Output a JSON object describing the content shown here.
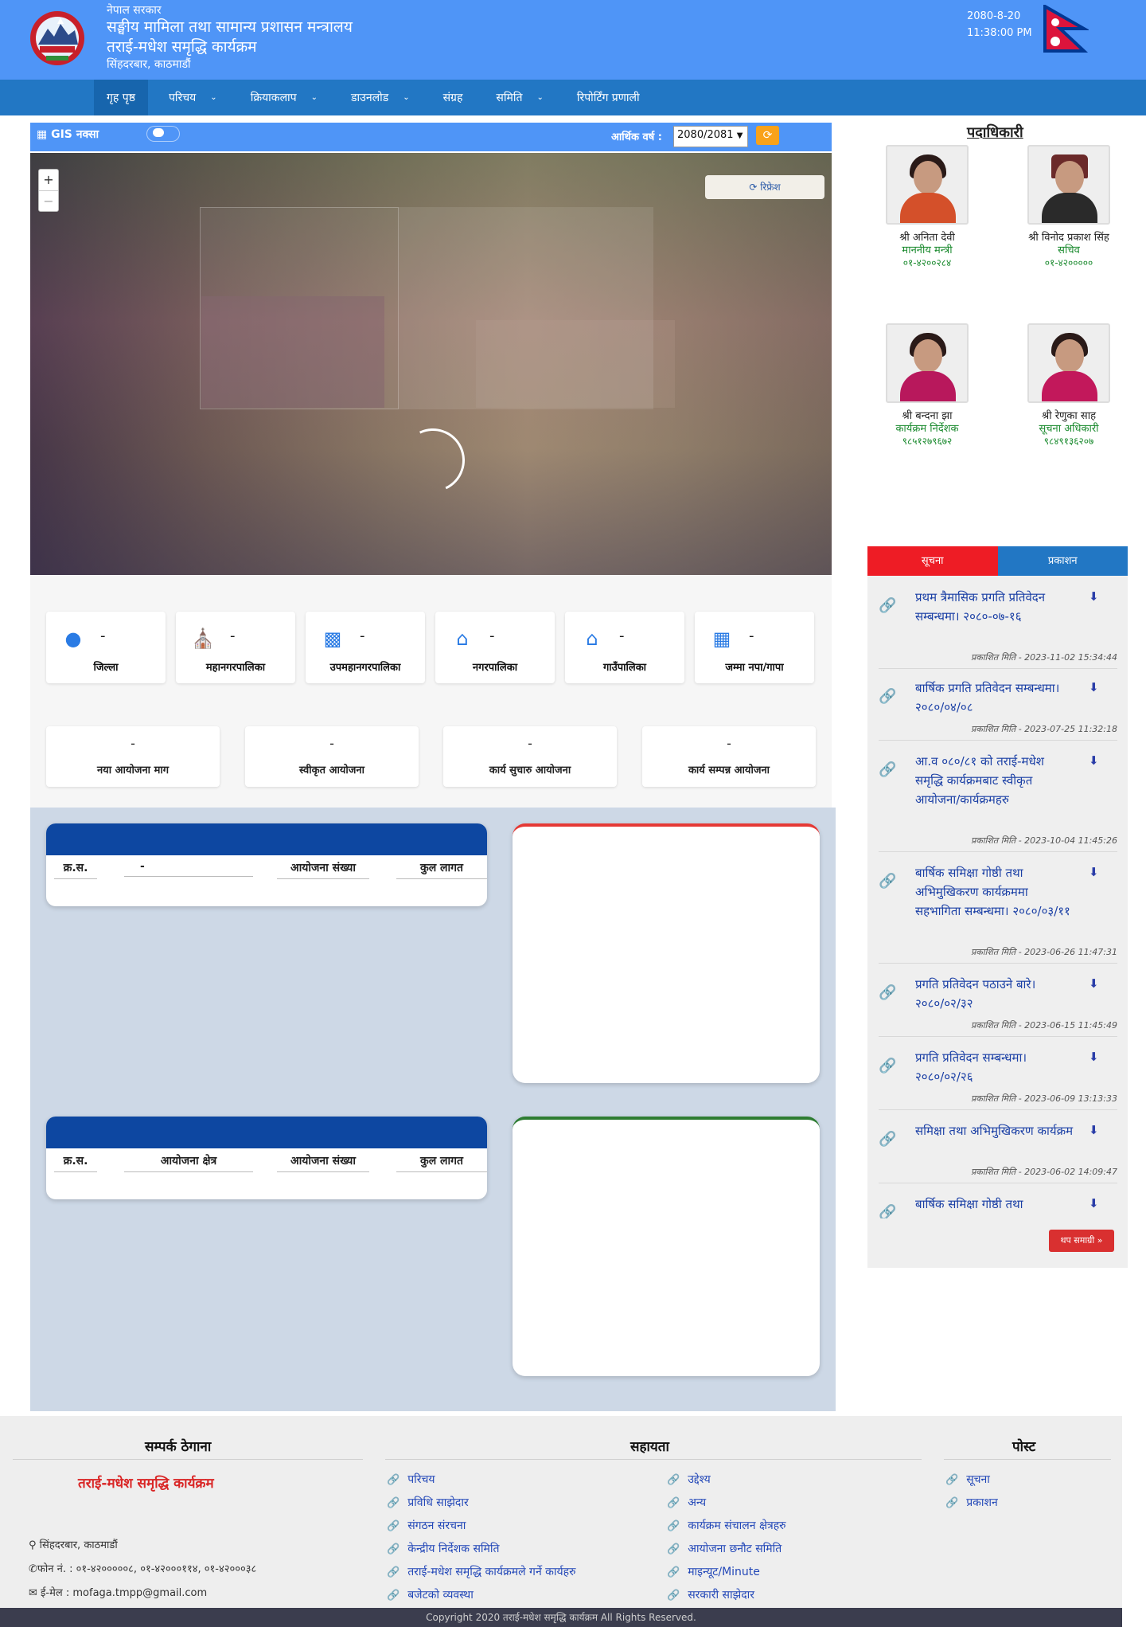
{
  "header": {
    "gov": "नेपाल सरकार",
    "ministry": "सङ्घीय मामिला तथा सामान्य प्रशासन मन्त्रालय",
    "program": "तराई-मधेश समृद्धि कार्यक्रम",
    "address": "सिंहदरबार, काठमाडौं",
    "date": "2080-8-20",
    "time": "11:38:00 PM"
  },
  "nav": {
    "home": "गृह पृष्ठ",
    "intro": "परिचय",
    "activities": "क्रियाकलाप",
    "download": "डाउनलोड",
    "gallery": "संग्रह",
    "committee": "समिति",
    "reporting": "रिपोर्टिंग प्रणाली"
  },
  "gis": {
    "label": "GIS नक्सा",
    "fy_label": "आर्थिक वर्ष :",
    "fy_value": "2080/2081",
    "map_refresh": "रिफ्रेश"
  },
  "stats": [
    {
      "value": "-",
      "label": "जिल्ला",
      "icon": "map-pin-icon"
    },
    {
      "value": "-",
      "label": "महानगरपालिका",
      "icon": "city-hall-icon"
    },
    {
      "value": "-",
      "label": "उपमहानगरपालिका",
      "icon": "buildings-icon"
    },
    {
      "value": "-",
      "label": "नगरपालिका",
      "icon": "town-icon"
    },
    {
      "value": "-",
      "label": "गाउँपालिका",
      "icon": "village-icon"
    },
    {
      "value": "-",
      "label": "जम्मा नपा/गापा",
      "icon": "grid-icon"
    }
  ],
  "projects": [
    {
      "value": "-",
      "label": "नया आयोजना माग"
    },
    {
      "value": "-",
      "label": "स्वीकृत आयोजना"
    },
    {
      "value": "-",
      "label": "कार्य सुचारु आयोजना"
    },
    {
      "value": "-",
      "label": "कार्य सम्पन्न आयोजना"
    }
  ],
  "table1": {
    "c1": "क्र.स.",
    "c2": "-",
    "c3": "आयोजना संख्या",
    "c4": "कुल लागत"
  },
  "table2": {
    "c1": "क्र.स.",
    "c2": "आयोजना क्षेत्र",
    "c3": "आयोजना संख्या",
    "c4": "कुल लागत"
  },
  "officials": {
    "title": "पदाधिकारी",
    "people": [
      {
        "name": "श्री अनिता देवी",
        "role": "माननीय मन्त्री",
        "phone": "०१-४२००२८४"
      },
      {
        "name": "श्री विनोद प्रकाश सिंह",
        "role": "सचिव",
        "phone": "०१-४२०००००"
      },
      {
        "name": "श्री बन्दना झा",
        "role": "कार्यक्रम निर्देशक",
        "phone": "९८५१२७९६७२"
      },
      {
        "name": "श्री रेणुका साह",
        "role": "सूचना अधिकारी",
        "phone": "९८४९१३६२०७"
      }
    ]
  },
  "news": {
    "tab_notice": "सूचना",
    "tab_publication": "प्रकाशन",
    "more": "थप समाग्री »",
    "items": [
      {
        "title": "प्रथम त्रैमासिक प्रगति प्रतिवेदन सम्बन्धमा। २०८०-०७-१६",
        "date": "प्रकाशित मिति - 2023-11-02 15:34:44"
      },
      {
        "title": "बार्षिक प्रगति प्रतिवेदन सम्बन्धमा।२०८०/०४/०८",
        "date": "प्रकाशित मिति - 2023-07-25 11:32:18"
      },
      {
        "title": "आ.व ०८०/८१ को तराई-मधेश समृद्धि कार्यक्रमबाट स्वीकृत आयोजना/कार्यक्रमहरु",
        "date": "प्रकाशित मिति - 2023-10-04 11:45:26"
      },
      {
        "title": "बार्षिक समिक्षा गोष्ठी तथा अभिमुखिकरण कार्यक्रममा सहभागिता सम्बन्धमा। २०८०/०३/११",
        "date": "प्रकाशित मिति - 2023-06-26 11:47:31"
      },
      {
        "title": "प्रगति प्रतिवेदन पठाउने बारे। २०८०/०२/३२",
        "date": "प्रकाशित मिति - 2023-06-15 11:45:49"
      },
      {
        "title": "प्रगति प्रतिवेदन सम्बन्धमा। २०८०/०२/२६",
        "date": "प्रकाशित मिति - 2023-06-09 13:13:33"
      },
      {
        "title": "समिक्षा तथा अभिमुखिकरण कार्यक्रम",
        "date": "प्रकाशित मिति - 2023-06-02 14:09:47"
      },
      {
        "title": "बार्षिक समिक्षा गोष्ठी तथा",
        "date": ""
      }
    ]
  },
  "footer": {
    "contact_title": "सम्पर्क ठेगाना",
    "help_title": "सहायता",
    "post_title": "पोस्ट",
    "org": "तराई-मधेश समृद्धि कार्यक्रम",
    "address": "सिंहदरबार, काठमाडौं",
    "phone": "फोन नं. : ०१-४२०००००८, ०१-४२०००११४, ०१-४२०००३८",
    "email_label": "ई-मेल :",
    "email": "mofaga.tmpp@gmail.com",
    "help_col1": [
      "परिचय",
      "प्रविधि साझेदार",
      "संगठन संरचना",
      "केन्द्रीय निर्देशक समिति",
      "तराई-मधेश समृद्धि कार्यक्रमले गर्ने कार्यहरु",
      "बजेटको व्यवस्था"
    ],
    "help_col2": [
      "उद्देश्य",
      "अन्य",
      "कार्यक्रम संचालन क्षेत्रहरु",
      "आयोजना छनौट समिति",
      "माइन्यूट/Minute",
      "सरकारी साझेदार"
    ],
    "post_links": [
      "सूचना",
      "प्रकाशन"
    ],
    "copyright": "Copyright 2020 तराई-मधेश समृद्धि कार्यक्रम All Rights Reserved."
  },
  "colors": {
    "header": "#4f95f7",
    "nav": "#2277c4",
    "table_head": "#0d47a1",
    "accent_red": "#ee1c25"
  }
}
